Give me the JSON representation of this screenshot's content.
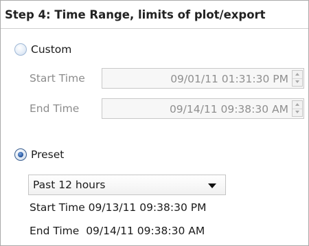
{
  "header": {
    "title": "Step 4: Time Range, limits of plot/export"
  },
  "custom": {
    "label": "Custom",
    "selected": false,
    "start_label": "Start Time",
    "start_value": "09/01/11 01:31:30 PM",
    "end_label": "End Time",
    "end_value": "09/14/11 09:38:30 AM"
  },
  "preset": {
    "label": "Preset",
    "selected": true,
    "dropdown_value": "Past 12 hours",
    "start_label": "Start Time",
    "start_value": "09/13/11 09:38:30 PM",
    "end_label": "End Time",
    "end_value": "09/14/11 09:38:30 AM"
  },
  "colors": {
    "radio_selected": "#1f4f99",
    "disabled_text": "#8c8c8c",
    "border": "#a9a9a9"
  }
}
